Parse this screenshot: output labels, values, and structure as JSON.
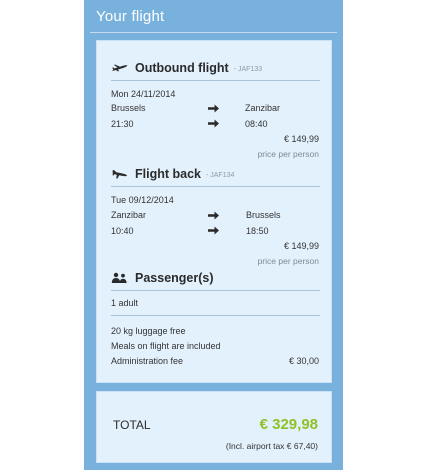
{
  "panel": {
    "title": "Your flight"
  },
  "outbound": {
    "title": "Outbound flight",
    "code": "- JAF133",
    "date": "Mon 24/11/2014",
    "from": "Brussels",
    "to": "Zanzibar",
    "depart_time": "21:30",
    "arrive_time": "08:40",
    "price": "€ 149,99",
    "price_note": "price per person"
  },
  "return": {
    "title": "Flight back",
    "code": "- JAF134",
    "date": "Tue 09/12/2014",
    "from": "Zanzibar",
    "to": "Brussels",
    "depart_time": "10:40",
    "arrive_time": "18:50",
    "price": "€ 149,99",
    "price_note": "price per person"
  },
  "passengers": {
    "title": "Passenger(s)",
    "count_label": "1 adult",
    "luggage": "20 kg luggage free",
    "meals": "Meals on flight are included",
    "admin_label": "Administration fee",
    "admin_fee": "€ 30,00"
  },
  "total": {
    "label": "TOTAL",
    "value": "€ 329,98",
    "tax_note": "(Incl. airport tax € 67,40)"
  },
  "colors": {
    "panel_bg": "#79b1dd",
    "card_bg": "#e3f1fd",
    "total_accent": "#8fc226"
  },
  "icons": {
    "outbound": "plane-takeoff-icon",
    "return": "plane-landing-icon",
    "passengers": "people-icon",
    "arrow": "arrow-right-icon"
  }
}
